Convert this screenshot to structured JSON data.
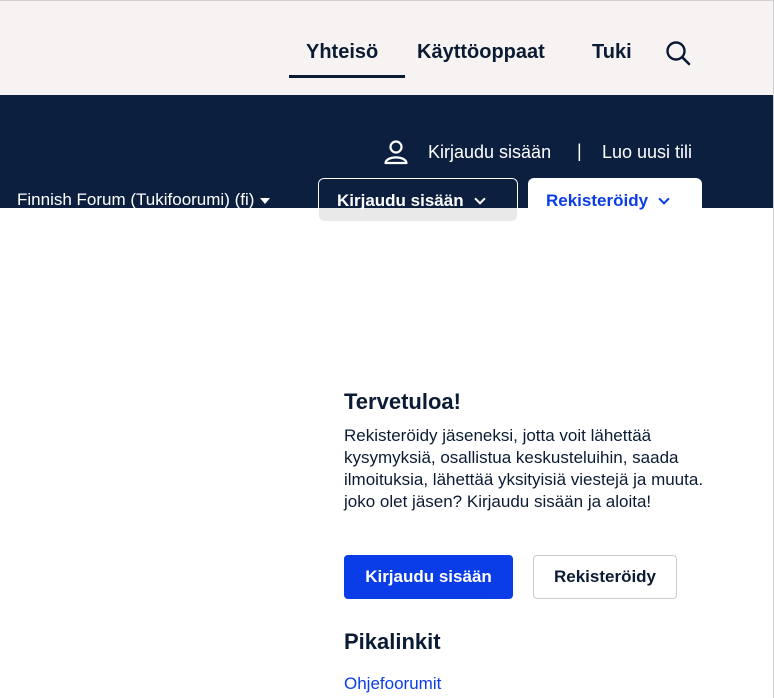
{
  "topnav": {
    "items": [
      {
        "label": "Yhteisö",
        "active": true
      },
      {
        "label": "Käyttöoppaat",
        "active": false
      },
      {
        "label": "Tuki",
        "active": false
      }
    ],
    "search_icon": "search-icon"
  },
  "header": {
    "login_link": "Kirjaudu sisään",
    "separator": "|",
    "register_link": "Luo uusi tili",
    "user_icon": "user-icon"
  },
  "subnav": {
    "forum_title": "Finnish Forum (Tukifoorumi) (fi)",
    "login_dropdown": "Kirjaudu sisään",
    "register_dropdown": "Rekisteröidy"
  },
  "welcome": {
    "title": "Tervetuloa!",
    "text": "Rekisteröidy jäseneksi, jotta voit lähettää kysymyksiä, osallistua keskusteluihin, saada ilmoituksia, lähettää yksityisiä viestejä ja muuta. joko olet jäsen? Kirjaudu sisään ja aloita!",
    "login_button": "Kirjaudu sisään",
    "register_button": "Rekisteröidy"
  },
  "quicklinks": {
    "title": "Pikalinkit",
    "links": [
      "Ohjefoorumit"
    ]
  },
  "colors": {
    "navy": "#0c1f3f",
    "accent_blue": "#0a3de8",
    "topbar_bg": "#f7f3f2"
  }
}
